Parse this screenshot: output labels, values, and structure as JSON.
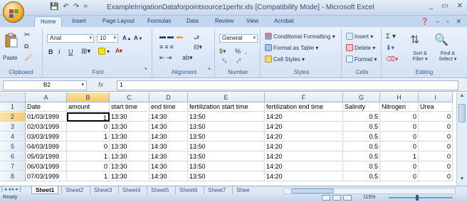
{
  "window": {
    "title": "ExampleIrrigationDataforpointsource1perhr.xls  [Compatibility Mode] - Microsoft Excel",
    "controls": [
      "_",
      "▭",
      "✕"
    ]
  },
  "qat": [
    "💾",
    "↶",
    "↷",
    "="
  ],
  "ribbon_tabs": [
    "Home",
    "Insert",
    "Page Layout",
    "Formulas",
    "Data",
    "Review",
    "View",
    "Acrobat"
  ],
  "active_tab": "Home",
  "ribbon": {
    "clipboard": {
      "label": "Clipboard",
      "paste": "Paste"
    },
    "font": {
      "label": "Font",
      "name": "Arial",
      "size": "10",
      "bold": "B",
      "italic": "I",
      "underline": "U"
    },
    "alignment": {
      "label": "Alignment"
    },
    "number": {
      "label": "Number",
      "format": "General",
      "pct": "%"
    },
    "styles": {
      "label": "Styles",
      "cond": "Conditional Formatting ▾",
      "table": "Format as Table ▾",
      "cell": "Cell Styles ▾"
    },
    "cells": {
      "label": "Cells",
      "insert": "Insert ▾",
      "delete": "Delete ▾",
      "format": "Format ▾"
    },
    "editing": {
      "label": "Editing",
      "sort": "Sort & Filter ▾",
      "find": "Find & Select ▾",
      "sigma": "Σ ▾"
    }
  },
  "formula_bar": {
    "name_box": "B2",
    "fx": "fx",
    "value": "1"
  },
  "columns": [
    "A",
    "B",
    "C",
    "D",
    "E",
    "F",
    "G",
    "H",
    "I"
  ],
  "rows": [
    "1",
    "2",
    "3",
    "4",
    "5",
    "6",
    "7",
    "8"
  ],
  "sheet": {
    "header": [
      "Date",
      "amount",
      "start time",
      "end time",
      "fertilization start time",
      "fertilization end time",
      "Salinity",
      "Nitrogen",
      "Urea"
    ],
    "data": [
      [
        "01/03/1999",
        "1",
        "13:30",
        "14:30",
        "13:50",
        "14:20",
        "0.5",
        "0",
        "0"
      ],
      [
        "02/03/1999",
        "0",
        "13:30",
        "14:30",
        "13:50",
        "14:20",
        "0.5",
        "0",
        "0"
      ],
      [
        "03/03/1999",
        "1",
        "13:30",
        "14:30",
        "13:50",
        "14:20",
        "0.5",
        "0",
        "0"
      ],
      [
        "04/03/1999",
        "0",
        "13:30",
        "14:30",
        "13:50",
        "14:20",
        "0.5",
        "0",
        "0"
      ],
      [
        "05/03/1999",
        "1",
        "13:30",
        "14:30",
        "13:50",
        "14:20",
        "0.5",
        "1",
        "0"
      ],
      [
        "06/03/1999",
        "0",
        "13:30",
        "14:30",
        "13:50",
        "14:20",
        "0.5",
        "0",
        "0"
      ],
      [
        "07/03/1999",
        "1",
        "13:30",
        "14:30",
        "13:50",
        "14:20",
        "0.5",
        "0",
        "0"
      ]
    ]
  },
  "sheet_tabs": [
    "Sheet1",
    "Sheet2",
    "Sheet3",
    "Sheet4",
    "Sheet5",
    "Sheet6",
    "Sheet7",
    "Shee"
  ],
  "active_sheet": "Sheet1",
  "status": {
    "ready": "Ready",
    "zoom": "115%"
  },
  "colors": {
    "accent": "#1e395b",
    "selection": "#f7c96b",
    "ribbon": "#dbe6f4"
  }
}
